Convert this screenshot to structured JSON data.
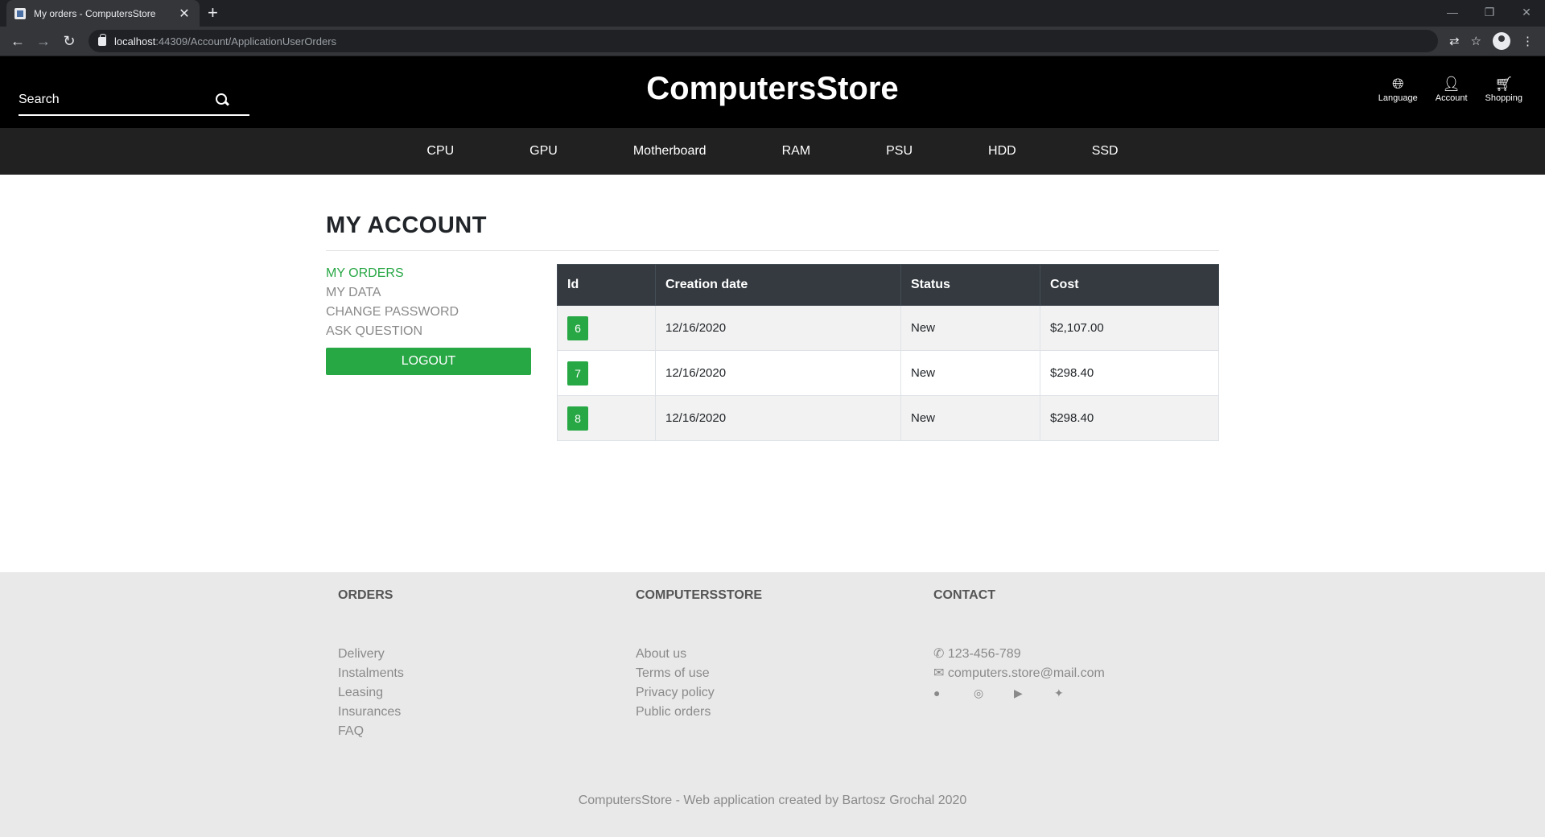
{
  "browser": {
    "tab_title": "My orders - ComputersStore",
    "url_host": "localhost",
    "url_path": ":44309/Account/ApplicationUserOrders"
  },
  "header": {
    "search_placeholder": "Search",
    "brand": "ComputersStore",
    "icons": [
      {
        "label": "Language",
        "icon": "globe-icon"
      },
      {
        "label": "Account",
        "icon": "user-icon"
      },
      {
        "label": "Shopping",
        "icon": "cart-icon"
      }
    ]
  },
  "categories": [
    "CPU",
    "GPU",
    "Motherboard",
    "RAM",
    "PSU",
    "HDD",
    "SSD"
  ],
  "account": {
    "title": "MY ACCOUNT",
    "menu": [
      "MY ORDERS",
      "MY DATA",
      "CHANGE PASSWORD",
      "ASK QUESTION"
    ],
    "active_menu": "MY ORDERS",
    "logout_label": "LOGOUT"
  },
  "orders": {
    "headers": [
      "Id",
      "Creation date",
      "Status",
      "Cost"
    ],
    "rows": [
      {
        "id": "6",
        "date": "12/16/2020",
        "status": "New",
        "cost": "$2,107.00"
      },
      {
        "id": "7",
        "date": "12/16/2020",
        "status": "New",
        "cost": "$298.40"
      },
      {
        "id": "8",
        "date": "12/16/2020",
        "status": "New",
        "cost": "$298.40"
      }
    ]
  },
  "footer": {
    "orders_title": "ORDERS",
    "orders_links": [
      "Delivery",
      "Instalments",
      "Leasing",
      "Insurances",
      "FAQ"
    ],
    "store_title": "COMPUTERSSTORE",
    "store_links": [
      "About us",
      "Terms of use",
      "Privacy policy",
      "Public orders"
    ],
    "contact_title": "CONTACT",
    "phone": "123-456-789",
    "email": "computers.store@mail.com",
    "social": [
      "facebook-icon",
      "instagram-icon",
      "youtube-icon",
      "twitter-icon"
    ],
    "copyright": "ComputersStore - Web application created by Bartosz Grochal 2020"
  },
  "colors": {
    "accent": "#28a745",
    "header_bg": "#000000",
    "nav_bg": "#212121",
    "table_head": "#343a40",
    "footer_bg": "#e9e9e9"
  }
}
